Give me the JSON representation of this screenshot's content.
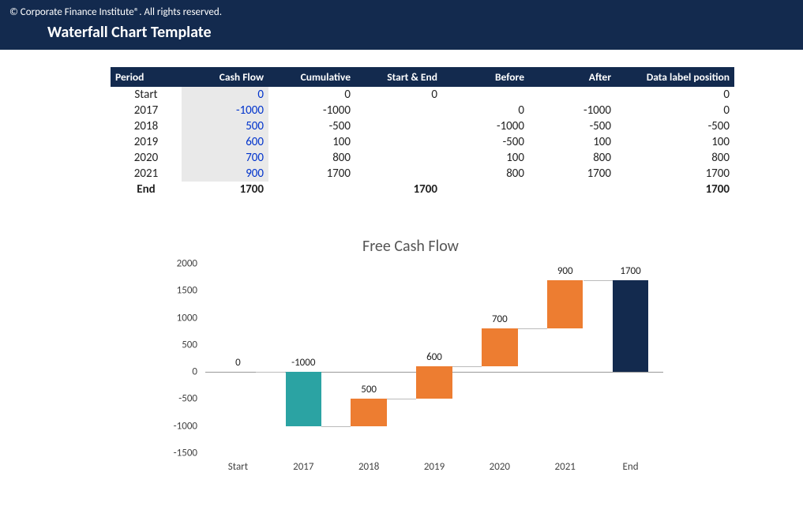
{
  "header": {
    "copyright": "© Corporate Finance Institute®. All rights reserved.",
    "title": "Waterfall Chart Template"
  },
  "table": {
    "columns": [
      "Period",
      "Cash Flow",
      "Cumulative",
      "Start & End",
      "Before",
      "After",
      "Data label position"
    ],
    "rows": [
      {
        "period": "Start",
        "cash_flow": "0",
        "cumulative": "0",
        "start_end": "0",
        "before": "",
        "after": "",
        "label_pos": "0"
      },
      {
        "period": "2017",
        "cash_flow": "-1000",
        "cumulative": "-1000",
        "start_end": "",
        "before": "0",
        "after": "-1000",
        "label_pos": "0"
      },
      {
        "period": "2018",
        "cash_flow": "500",
        "cumulative": "-500",
        "start_end": "",
        "before": "-1000",
        "after": "-500",
        "label_pos": "-500"
      },
      {
        "period": "2019",
        "cash_flow": "600",
        "cumulative": "100",
        "start_end": "",
        "before": "-500",
        "after": "100",
        "label_pos": "100"
      },
      {
        "period": "2020",
        "cash_flow": "700",
        "cumulative": "800",
        "start_end": "",
        "before": "100",
        "after": "800",
        "label_pos": "800"
      },
      {
        "period": "2021",
        "cash_flow": "900",
        "cumulative": "1700",
        "start_end": "",
        "before": "800",
        "after": "1700",
        "label_pos": "1700"
      },
      {
        "period": "End",
        "cash_flow": "1700",
        "cumulative": "",
        "start_end": "1700",
        "before": "",
        "after": "",
        "label_pos": "1700"
      }
    ]
  },
  "chart_data": {
    "type": "bar",
    "title": "Free Cash Flow",
    "ylabel": "",
    "xlabel": "",
    "ylim": [
      -1500,
      2000
    ],
    "yticks": [
      -1500,
      -1000,
      -500,
      0,
      500,
      1000,
      1500,
      2000
    ],
    "categories": [
      "Start",
      "2017",
      "2018",
      "2019",
      "2020",
      "2021",
      "End"
    ],
    "steps": [
      {
        "name": "Start",
        "kind": "start",
        "from": 0,
        "to": 0,
        "delta": 0,
        "label": "0"
      },
      {
        "name": "2017",
        "kind": "down",
        "from": 0,
        "to": -1000,
        "delta": -1000,
        "label": "-1000"
      },
      {
        "name": "2018",
        "kind": "up",
        "from": -1000,
        "to": -500,
        "delta": 500,
        "label": "500"
      },
      {
        "name": "2019",
        "kind": "up",
        "from": -500,
        "to": 100,
        "delta": 600,
        "label": "600"
      },
      {
        "name": "2020",
        "kind": "up",
        "from": 100,
        "to": 800,
        "delta": 700,
        "label": "700"
      },
      {
        "name": "2021",
        "kind": "up",
        "from": 800,
        "to": 1700,
        "delta": 900,
        "label": "900"
      },
      {
        "name": "End",
        "kind": "end",
        "from": 0,
        "to": 1700,
        "delta": 1700,
        "label": "1700"
      }
    ]
  }
}
